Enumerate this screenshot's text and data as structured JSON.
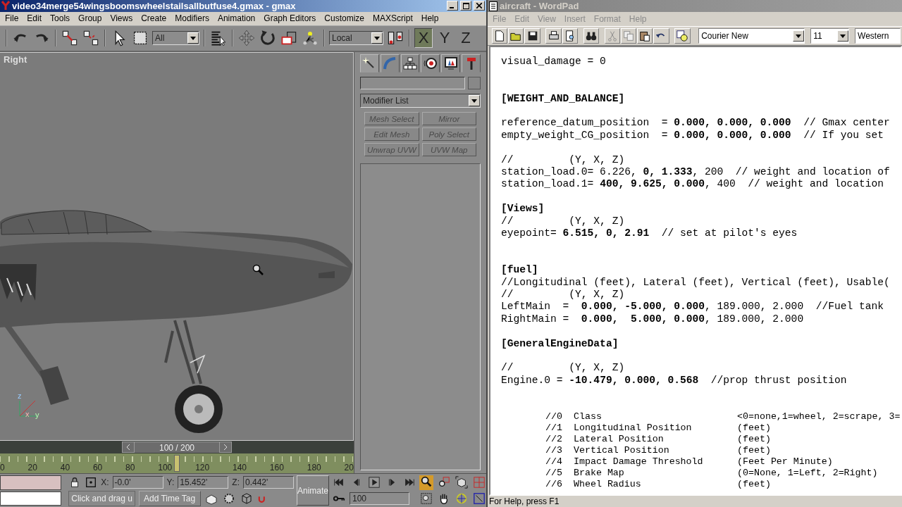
{
  "gmax": {
    "title": "video34merge54wingsboomswheelstailsallbutfuse4.gmax - gmax",
    "menu": [
      "File",
      "Edit",
      "Tools",
      "Group",
      "Views",
      "Create",
      "Modifiers",
      "Animation",
      "Graph Editors",
      "Customize",
      "MAXScript",
      "Help"
    ],
    "toolbar": {
      "selection_filter": "All",
      "coordinate_system": "Local",
      "axis_constraints": [
        {
          "label": "X",
          "selected": true
        },
        {
          "label": "Y",
          "selected": false
        },
        {
          "label": "Z",
          "selected": false
        }
      ]
    },
    "viewport": {
      "label": "Right",
      "axis_labels": [
        "z",
        "x",
        "y"
      ]
    },
    "command_panel": {
      "tabs": [
        {
          "selected": true
        },
        {
          "selected": false
        },
        {
          "selected": false
        },
        {
          "selected": false
        },
        {
          "selected": false
        },
        {
          "selected": false
        }
      ],
      "modifier_list": "Modifier List",
      "modifier_buttons": [
        {
          "label": "Mesh Select",
          "disabled": true
        },
        {
          "label": "Mirror",
          "disabled": true
        },
        {
          "label": "Edit Mesh",
          "disabled": true
        },
        {
          "label": "Poly Select",
          "disabled": true
        },
        {
          "label": "Unwrap UVW",
          "disabled": true
        },
        {
          "label": "UVW Map",
          "disabled": true
        }
      ]
    },
    "time_slider": {
      "label": "100 / 200",
      "level": 0.5
    },
    "track_bar": {
      "ticks": [
        "0",
        "20",
        "40",
        "60",
        "80",
        "100",
        "120",
        "140",
        "160",
        "180",
        "20"
      ]
    },
    "status": {
      "coords": [
        {
          "axis": "X:",
          "value": "-0.0'"
        },
        {
          "axis": "Y:",
          "value": "15.452'"
        },
        {
          "axis": "Z:",
          "value": "0.442'"
        }
      ],
      "animate": "Animate",
      "frame": "100",
      "prompt": "Click and drag u",
      "time_tag": "Add Time Tag"
    }
  },
  "wordpad": {
    "title": "aircraft - WordPad",
    "menu": [
      "File",
      "Edit",
      "View",
      "Insert",
      "Format",
      "Help"
    ],
    "format_bar": {
      "font": "Courier New",
      "size": "11",
      "script": "Western"
    },
    "blocks": [
      {
        "extra_space": false,
        "lines": [
          "visual_damage = 0"
        ]
      },
      {
        "extra_space": true,
        "heading": "[WEIGHT_AND_BALANCE]"
      },
      {
        "extra_space": false,
        "lines": [
          "reference_datum_position  = **0.000, 0.000, 0.000**  // Gmax center",
          "empty_weight_CG_position  = **0.000, 0.000, 0.000**  // If you set"
        ]
      },
      {
        "extra_space": false,
        "lines": [
          "//         (Y, X, Z)",
          "station_load.0= 6.226, **0, 1.333**, 200  // weight and location of",
          "station_load.1= **400, 9.625, 0.000**, 400  // weight and location"
        ]
      },
      {
        "extra_space": false,
        "heading": "[Views]",
        "lines": [
          "//         (Y, X, Z)",
          "eyepoint= **6.515, 0, 2.91**  // set at pilot's eyes"
        ]
      },
      {
        "extra_space": true,
        "heading": "[fuel]",
        "lines": [
          "//Longitudinal (feet), Lateral (feet), Vertical (feet), Usable(",
          "//         (Y, X, Z)",
          "LeftMain  =  **0.000, -5.000, 0.000**, 189.000, 2.000  //Fuel tank",
          "RightMain =  **0.000,  5.000, 0.000**, 189.000, 2.000"
        ]
      },
      {
        "extra_space": false,
        "heading": "[GeneralEngineData]"
      },
      {
        "extra_space": false,
        "lines": [
          "//         (Y, X, Z)",
          "Engine.0 = **-10.479, 0.000, 0.568**  //prop thrust position"
        ]
      }
    ],
    "legend": [
      {
        "code": "//0",
        "name": "Class",
        "unit": "<0=none,1=wheel, 2=scrape, 3="
      },
      {
        "code": "//1",
        "name": "Longitudinal Position",
        "unit": "(feet)"
      },
      {
        "code": "//2",
        "name": "Lateral Position",
        "unit": "(feet)"
      },
      {
        "code": "//3",
        "name": "Vertical Position",
        "unit": "(feet)"
      },
      {
        "code": "//4",
        "name": "Impact Damage Threshold",
        "unit": "(Feet Per Minute)"
      },
      {
        "code": "//5",
        "name": "Brake Map",
        "unit": "(0=None, 1=Left, 2=Right)"
      },
      {
        "code": "//6",
        "name": "Wheel Radius",
        "unit": "(feet)"
      }
    ],
    "status": "For Help, press F1"
  }
}
